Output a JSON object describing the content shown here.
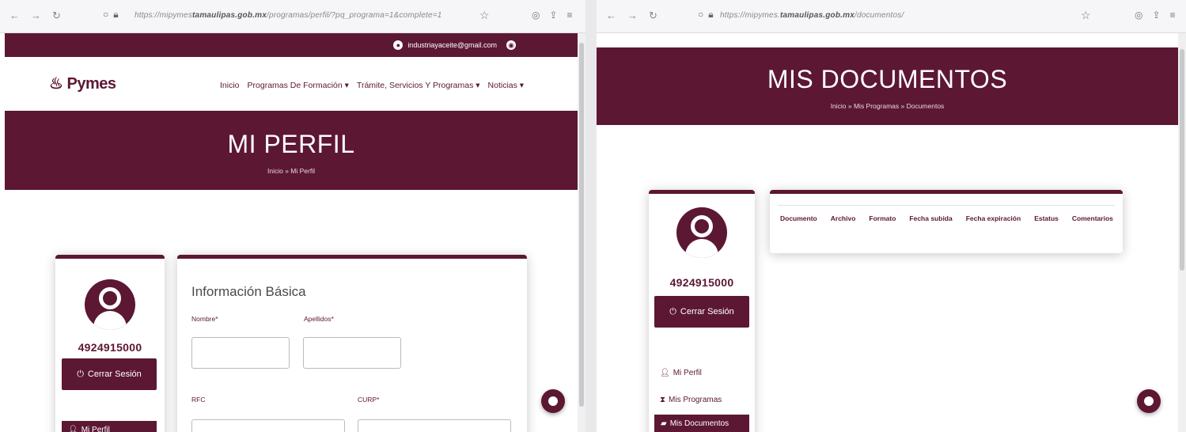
{
  "left": {
    "browser": {
      "url_prefix": "https://mipymes",
      "url_host": "tamaulipas.gob.mx",
      "url_path": "/programas/perfil/?pq_programa=1&complete=1"
    },
    "topbar": {
      "email": "industriayaceite@gmail.com"
    },
    "header": {
      "logo_text": "Pymes",
      "menu": [
        "Inicio",
        "Programas De Formación ▾",
        "Trámite, Servicios Y Programas ▾",
        "Noticias ▾"
      ]
    },
    "hero": {
      "title": "MI PERFIL",
      "breadcrumb": "Inicio » Mi Perfil"
    },
    "profile": {
      "user_id": "4924915000",
      "logout_label": "Cerrar Sesión",
      "first_menu_item": "Mi Perfil"
    },
    "form": {
      "title": "Información Básica",
      "labels": {
        "nombre": "Nombre*",
        "apellidos": "Apellidos*",
        "rfc": "RFC",
        "curp": "CURP*"
      }
    }
  },
  "right": {
    "browser": {
      "url_prefix": "https://mipymes.",
      "url_host": "tamaulipas.gob.mx",
      "url_path": "/documentos/"
    },
    "hero": {
      "title": "MIS DOCUMENTOS",
      "breadcrumb": "Inicio » Mis Programas » Documentos"
    },
    "profile": {
      "user_id": "4924915000",
      "logout_label": "Cerrar Sesión",
      "menu": [
        "Mi Perfil",
        "Mis Programas",
        "Mis Documentos"
      ]
    },
    "table": {
      "headers": [
        "Documento",
        "Archivo",
        "Formato",
        "Fecha subida",
        "Fecha expiración",
        "Estatus",
        "Comentarios"
      ]
    }
  },
  "colors": {
    "brand": "#5c1733",
    "chrome": "#f6f6f8"
  }
}
